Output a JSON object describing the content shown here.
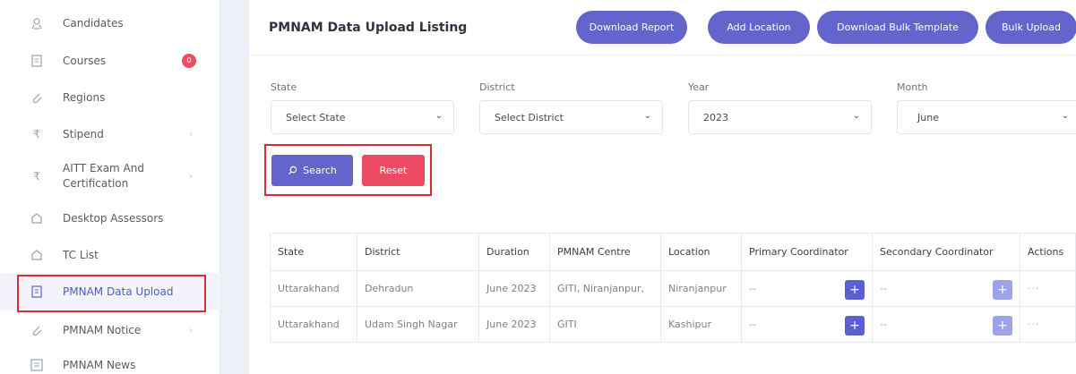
{
  "sidebar": {
    "items": [
      {
        "label": "Candidates",
        "icon": "id-badge-icon"
      },
      {
        "label": "Courses",
        "icon": "document-icon",
        "badge": "0"
      },
      {
        "label": "Regions",
        "icon": "paperclip-icon"
      },
      {
        "label": "Stipend",
        "icon": "rupee-icon",
        "chevron": true
      },
      {
        "label": "AITT Exam And",
        "label2": "Certification",
        "icon": "rupee-icon",
        "chevron": true
      },
      {
        "label": "Desktop Assessors",
        "icon": "home-icon"
      },
      {
        "label": "TC List",
        "icon": "home-icon"
      },
      {
        "label": "PMNAM Data Upload",
        "icon": "document-icon"
      },
      {
        "label": "PMNAM Notice",
        "icon": "paperclip-icon",
        "chevron": true
      },
      {
        "label": "PMNAM News",
        "icon": "list-icon"
      }
    ]
  },
  "main": {
    "title": "PMNAM Data Upload Listing",
    "buttons": {
      "download_report": "Download Report",
      "add_location": "Add Location",
      "download_bulk_template": "Download Bulk Template",
      "bulk_upload": "Bulk Upload"
    },
    "filters": {
      "state_label": "State",
      "state_value": "Select State",
      "district_label": "District",
      "district_value": "Select District",
      "year_label": "Year",
      "year_value": "2023",
      "month_label": "Month",
      "month_value": "June"
    },
    "search_label": "Search",
    "reset_label": "Reset",
    "table": {
      "headers": [
        "State",
        "District",
        "Duration",
        "PMNAM Centre",
        "Location",
        "Primary Coordinator",
        "Secondary Coordinator",
        "Actions"
      ],
      "rows": [
        {
          "state": "Uttarakhand",
          "district": "Dehradun",
          "duration": "June 2023",
          "centre": "GITI, Niranjanpur,",
          "location": "Niranjanpur",
          "primary": "--",
          "secondary": "--",
          "actions": "···"
        },
        {
          "state": "Uttarakhand",
          "district": "Udam Singh Nagar",
          "duration": "June 2023",
          "centre": "GITI",
          "location": "Kashipur",
          "primary": "--",
          "secondary": "--",
          "actions": "···"
        }
      ]
    }
  },
  "colors": {
    "accent": "#6465cc",
    "danger": "#ed4b63",
    "highlight": "#d72f3a"
  }
}
